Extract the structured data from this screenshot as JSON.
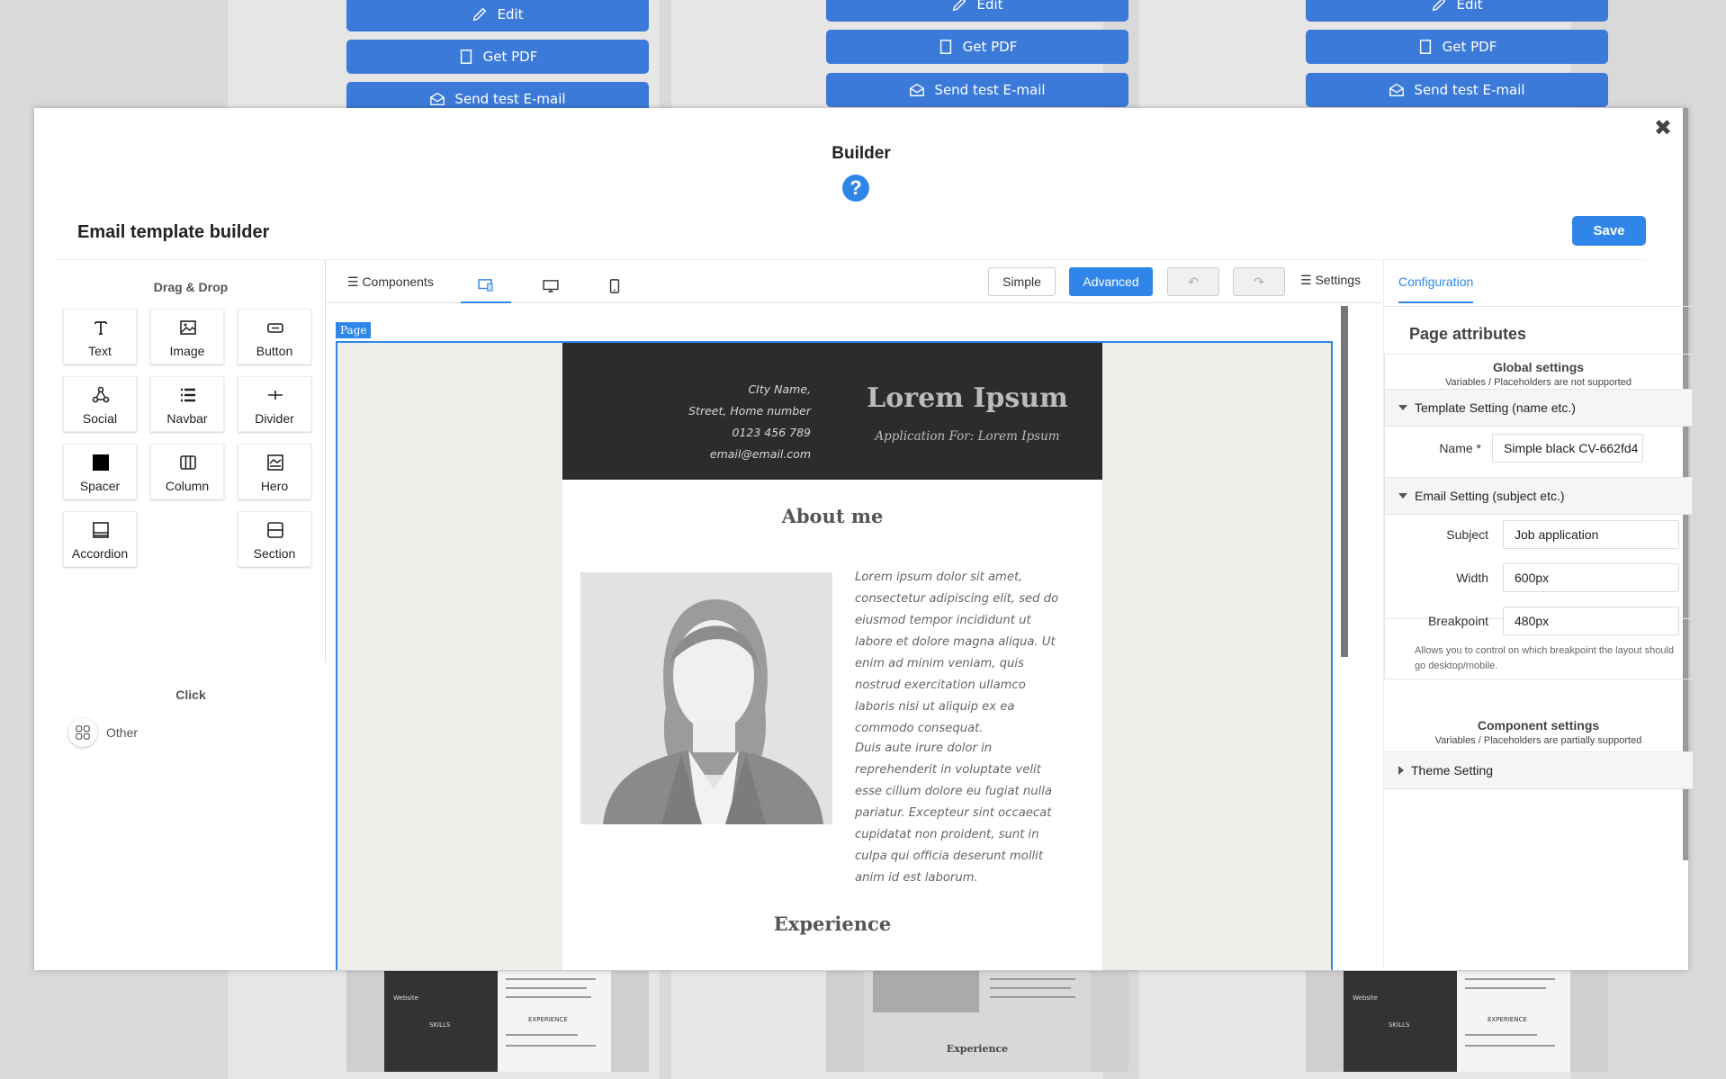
{
  "background_cards": {
    "edit_label": "Edit",
    "pdf_label": "Get PDF",
    "email_label": "Send test E-mail",
    "thumb_experience": "Experience",
    "thumb_skills": "SKILLS",
    "thumb_website": "Website",
    "thumb_experience_caps": "EXPERIENCE"
  },
  "modal": {
    "title": "Builder",
    "help_symbol": "?",
    "close_symbol": "✖",
    "builder_title": "Email template builder",
    "save_label": "Save"
  },
  "left_panel": {
    "drag_drop_heading": "Drag & Drop",
    "blocks": [
      {
        "label": "Text",
        "icon": "text-icon"
      },
      {
        "label": "Image",
        "icon": "image-icon"
      },
      {
        "label": "Button",
        "icon": "button-icon"
      },
      {
        "label": "Social",
        "icon": "social-icon"
      },
      {
        "label": "Navbar",
        "icon": "navbar-icon"
      },
      {
        "label": "Divider",
        "icon": "divider-icon"
      },
      {
        "label": "Spacer",
        "icon": "spacer-icon"
      },
      {
        "label": "Column",
        "icon": "column-icon"
      },
      {
        "label": "Hero",
        "icon": "hero-icon"
      },
      {
        "label": "Accordion",
        "icon": "accordion-icon"
      },
      {
        "label": "Section",
        "icon": "section-icon"
      }
    ],
    "click_heading": "Click",
    "other_label": "Other"
  },
  "toolbar": {
    "components_label": "☰ Components",
    "simple_label": "Simple",
    "advanced_label": "Advanced",
    "settings_label": "☰ Settings",
    "undo_symbol": "↶",
    "redo_symbol": "↷"
  },
  "canvas": {
    "page_tag": "Page",
    "address_lines": [
      "CIty Name,",
      "Street, Home number",
      "0123 456 789",
      "email@email.com"
    ],
    "header_title": "Lorem Ipsum",
    "header_subtitle": "Application For: Lorem Ipsum",
    "about_title": "About me",
    "bio_paragraph_1": "Lorem ipsum dolor sit amet, consectetur adipiscing elit, sed do eiusmod tempor incididunt ut labore et dolore magna aliqua. Ut enim ad minim veniam, quis nostrud exercitation ullamco laboris nisi ut aliquip ex ea commodo consequat.",
    "bio_paragraph_2": "Duis aute irure dolor in reprehenderit in voluptate velit esse cillum dolore eu fugiat nulla pariatur. Excepteur sint occaecat cupidatat non proident, sunt in culpa qui officia deserunt mollit anim id est laborum.",
    "experience_title": "Experience"
  },
  "right_panel": {
    "config_tab": "Configuration",
    "page_attributes": "Page attributes",
    "global_settings": "Global settings",
    "global_note": "Variables / Placeholders are not supported",
    "template_section": "Template Setting (name etc.)",
    "name_label": "Name *",
    "name_value": "Simple black CV-662fd4",
    "email_section": "Email Setting (subject etc.)",
    "subject_label": "Subject",
    "subject_value": "Job application",
    "width_label": "Width",
    "width_value": "600px",
    "breakpoint_label": "Breakpoint",
    "breakpoint_value": "480px",
    "breakpoint_hint": "Allows you to control on which breakpoint the layout should go desktop/mobile.",
    "component_settings": "Component settings",
    "component_note": "Variables / Placeholders are partially supported",
    "theme_section": "Theme Setting"
  },
  "colors": {
    "accent": "#2f86e8",
    "bg_button": "#3c7ad9",
    "email_header": "#2c2c2c"
  }
}
